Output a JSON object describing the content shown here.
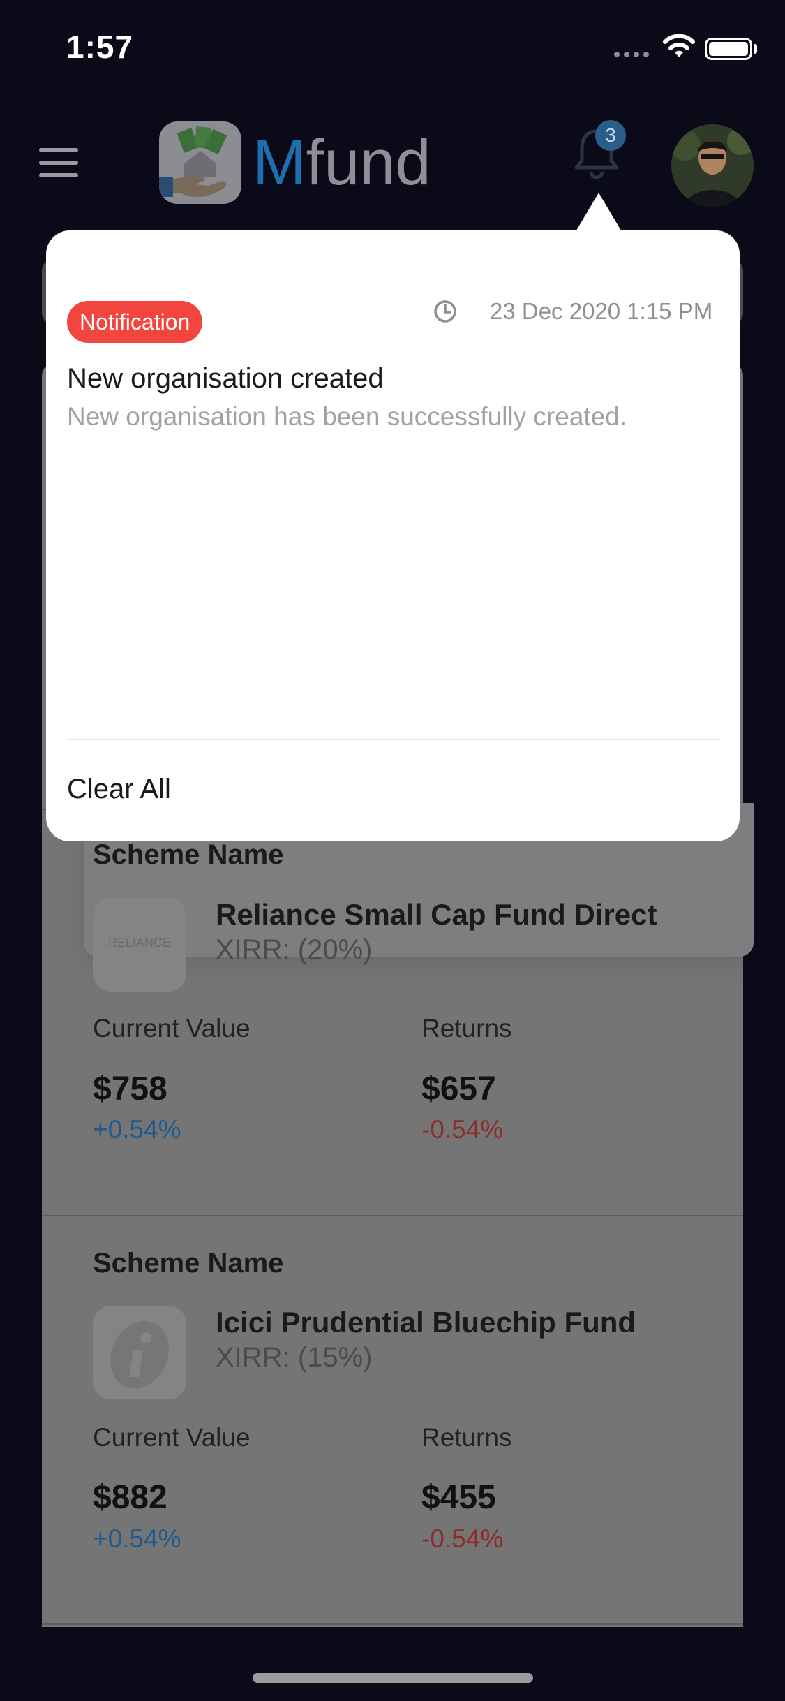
{
  "status_bar": {
    "time": "1:57"
  },
  "header": {
    "app_name_accent": "M",
    "app_name_rest": "fund",
    "notification_count": "3"
  },
  "notification_popup": {
    "items": [
      {
        "badge": "Notification",
        "timestamp": "23 Dec 2020 1:15 PM",
        "title": "New organisation created",
        "body": "New organisation has been successfully created."
      }
    ],
    "clear_all_label": "Clear All"
  },
  "funds": [
    {
      "scheme_label": "Scheme Name",
      "name": "Reliance Small Cap Fund Direct",
      "logo_text": "RELIANCE",
      "xirr": "XIRR: (20%)",
      "current_value_label": "Current Value",
      "current_value": "$758",
      "current_change": "+0.54%",
      "returns_label": "Returns",
      "returns_value": "$657",
      "returns_change": "-0.54%"
    },
    {
      "scheme_label": "Scheme Name",
      "name": "Icici Prudential Bluechip Fund",
      "logo_text": "",
      "xirr": "XIRR: (15%)",
      "current_value_label": "Current Value",
      "current_value": "$882",
      "current_change": "+0.54%",
      "returns_label": "Returns",
      "returns_value": "$455",
      "returns_change": "-0.54%"
    }
  ],
  "colors": {
    "background": "#0b0a18",
    "brand_blue": "#1f6fb0",
    "badge_red": "#f1453d",
    "positive": "#1f5a8e",
    "negative": "#8e2b2b"
  },
  "icons": [
    "hamburger-menu-icon",
    "bell-icon",
    "clock-icon",
    "wifi-icon",
    "battery-icon"
  ]
}
